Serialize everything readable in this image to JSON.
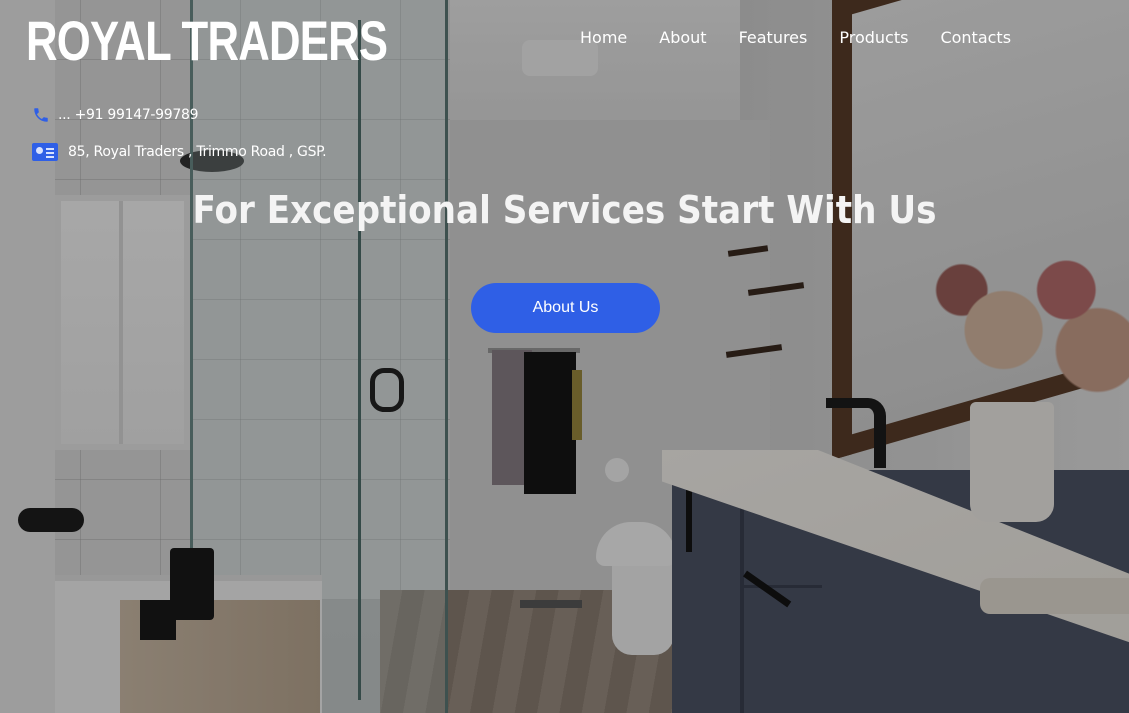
{
  "brand": {
    "name": "ROYAL TRADERS"
  },
  "nav": {
    "items": [
      {
        "label": "Home"
      },
      {
        "label": "About"
      },
      {
        "label": "Features"
      },
      {
        "label": "Products"
      },
      {
        "label": "Contacts"
      }
    ]
  },
  "contact": {
    "phone": "... +91 99147-99789",
    "phone_icon": "phone-icon",
    "address": "85, Royal Traders , Trimmo Road , GSP.",
    "address_icon": "id-card-icon"
  },
  "hero": {
    "headline": "For Exceptional Services Start With Us",
    "cta_label": "About Us"
  },
  "colors": {
    "accent": "#2f5fe6",
    "text": "#ffffff"
  }
}
